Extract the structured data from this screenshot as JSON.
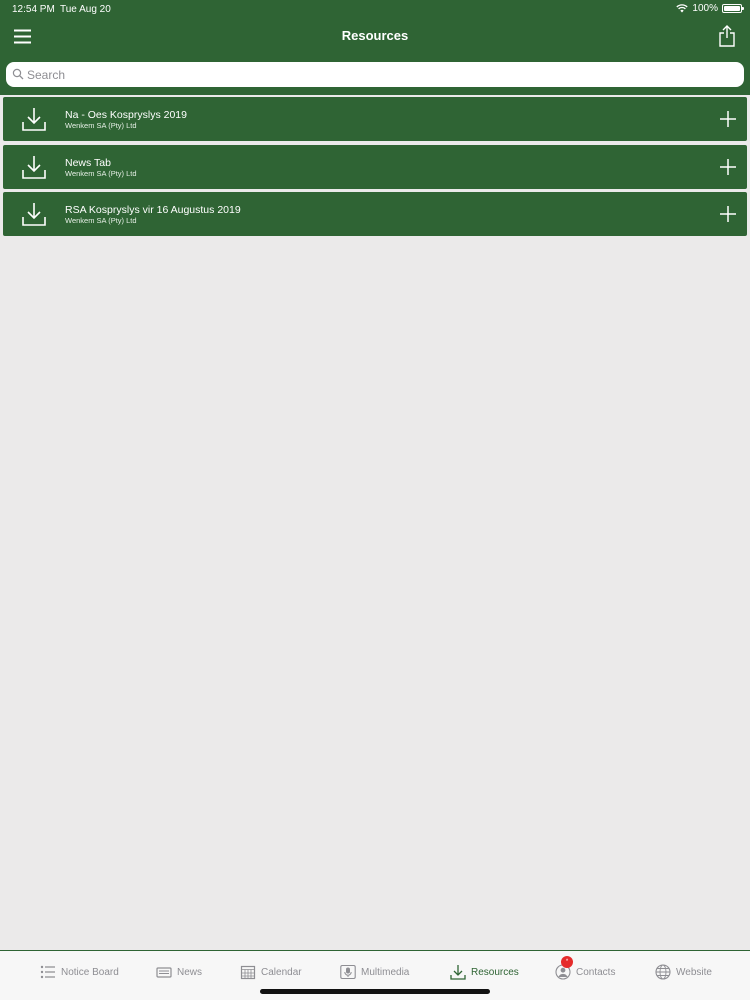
{
  "status_bar": {
    "time": "12:54 PM",
    "date": "Tue Aug 20",
    "battery": "100%",
    "battery_level": 1.0
  },
  "header": {
    "title": "Resources",
    "menu_icon": "hamburger-menu-icon",
    "share_icon": "share-icon"
  },
  "search": {
    "placeholder": "Search",
    "value": ""
  },
  "resources": [
    {
      "title": "Na - Oes Kospryslys 2019",
      "subtitle": "Wenkem SA (Pty) Ltd"
    },
    {
      "title": "News Tab",
      "subtitle": "Wenkem SA (Pty) Ltd"
    },
    {
      "title": "RSA Kospryslys vir 16 Augustus 2019",
      "subtitle": "Wenkem SA (Pty) Ltd"
    }
  ],
  "tabs": [
    {
      "label": "Notice Board",
      "icon": "list-icon"
    },
    {
      "label": "News",
      "icon": "newspaper-icon"
    },
    {
      "label": "Calendar",
      "icon": "calendar-icon"
    },
    {
      "label": "Multimedia",
      "icon": "microphone-icon"
    },
    {
      "label": "Resources",
      "icon": "download-icon",
      "active": true
    },
    {
      "label": "Contacts",
      "icon": "contacts-icon",
      "badge": "*"
    },
    {
      "label": "Website",
      "icon": "globe-icon"
    }
  ],
  "colors": {
    "brand_green": "#2f6434",
    "background": "#ebeaea",
    "badge_red": "#e52b2b",
    "inactive_tab": "#8e8e93"
  }
}
